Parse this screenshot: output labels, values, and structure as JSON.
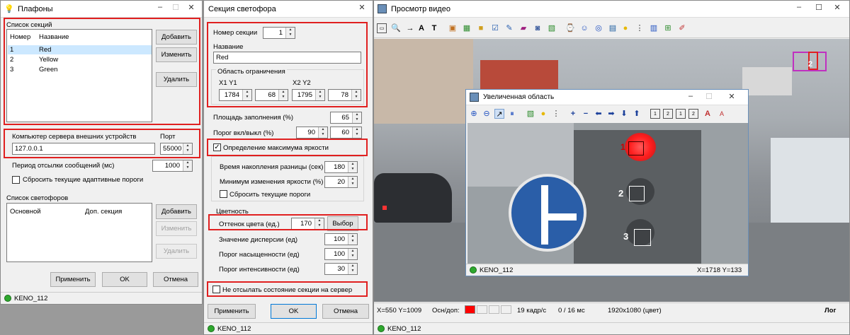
{
  "win1": {
    "title": "Плафоны",
    "sections_group": "Список секций",
    "col_num": "Номер",
    "col_name": "Название",
    "rows": [
      {
        "n": "1",
        "name": "Red"
      },
      {
        "n": "2",
        "name": "Yellow"
      },
      {
        "n": "3",
        "name": "Green"
      }
    ],
    "add": "Добавить",
    "edit": "Изменить",
    "delete": "Удалить",
    "server_label": "Компьютер сервера внешних устройств",
    "port_label": "Порт",
    "server": "127.0.0.1",
    "port": "55000",
    "period_label": "Период отсылки сообщений (мс)",
    "period": "1000",
    "reset_label": "Сбросить текущие адаптивные пороги",
    "lights_group": "Список светофоров",
    "col_main": "Основной",
    "col_extra": "Доп. секция",
    "add2": "Добавить",
    "edit2": "Изменить",
    "delete2": "Удалить",
    "apply": "Применить",
    "ok": "OK",
    "cancel": "Отмена",
    "status": "KENO_112"
  },
  "win2": {
    "title": "Секция светофора",
    "num_label": "Номер секции",
    "num": "1",
    "name_label": "Название",
    "name": "Red",
    "area_label": "Область ограничения",
    "x1y1": "X1 Y1",
    "x2y2": "X2 Y2",
    "x1": "1784",
    "y1": "68",
    "x2": "1795",
    "y2": "78",
    "fill_label": "Площадь заполнения (%)",
    "fill": "65",
    "thr_label": "Порог вкл/выкл (%)",
    "thr1": "90",
    "thr2": "60",
    "maxb_label": "Определение максимума яркости",
    "acc_label": "Время накопления разницы (сек)",
    "acc": "180",
    "minb_label": "Минимум изменения яркости (%)",
    "minb": "20",
    "resetthr_label": "Сбросить текущие пороги",
    "color_group": "Цветность",
    "hue_label": "Оттенок цвета (ед.)",
    "hue": "170",
    "pick": "Выбор",
    "disp_label": "Значение дисперсии (ед)",
    "disp": "100",
    "sat_label": "Порог насыщенности (ед)",
    "sat": "100",
    "int_label": "Порог интенсивности  (ед)",
    "int": "30",
    "nosend_label": "Не отсылать состояние секции на сервер",
    "apply": "Применить",
    "ok": "OK",
    "cancel": "Отмена",
    "status": "KENO_112"
  },
  "win3": {
    "title": "Просмотр видео",
    "coords": "X=550 Y=1009",
    "main_extra": "Осн/доп:",
    "fps": "19 кадр/с",
    "ms": "0 / 16 мс",
    "res": "1920x1080 (цвет)",
    "status": "KENO_112",
    "log": "Лог",
    "roi_tag": "2"
  },
  "zoom": {
    "title": "Увеличенная область",
    "status": "KENO_112",
    "coords": "X=1718 Y=133",
    "labels": [
      "1",
      "2",
      "3"
    ]
  },
  "colors": {
    "accent_red": "#e02020",
    "selection": "#cce8ff",
    "status_green": "#2ea82e"
  },
  "icons": [
    "zoom-in-icon",
    "zoom-out-icon",
    "lightbulb-icon",
    "traffic-light-icon",
    "arrow-left-icon",
    "arrow-right-icon",
    "arrow-up-icon",
    "arrow-down-icon"
  ]
}
